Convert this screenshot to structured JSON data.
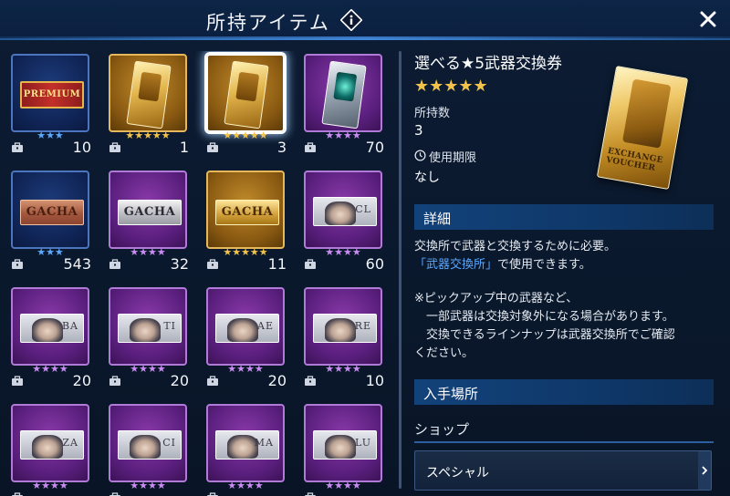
{
  "header": {
    "title": "所持アイテム",
    "info_icon": "info-icon",
    "close_icon": "close-icon"
  },
  "grid": [
    {
      "kind": "ticket-premium",
      "label": "PREMIUM",
      "stars": "★★★",
      "star_color": "#5aa9ff",
      "rarity": 3,
      "qty": "10"
    },
    {
      "kind": "voucher-gold",
      "stars": "★★★★★",
      "star_color": "#f2c24a",
      "rarity": 5,
      "qty": "1"
    },
    {
      "kind": "voucher-gold",
      "stars": "★★★★★",
      "star_color": "#f2c24a",
      "rarity": 5,
      "qty": "3",
      "selected": true
    },
    {
      "kind": "voucher-silver",
      "stars": "★★★★",
      "star_color": "#c98cf2",
      "rarity": 4,
      "qty": "70"
    },
    {
      "kind": "ticket-copper",
      "label": "GACHA",
      "stars": "★★★",
      "star_color": "#5aa9ff",
      "rarity": 3,
      "qty": "543"
    },
    {
      "kind": "ticket-silver",
      "label": "GACHA",
      "stars": "★★★★",
      "star_color": "#c98cf2",
      "rarity": 4,
      "qty": "32"
    },
    {
      "kind": "ticket-gold",
      "label": "GACHA",
      "stars": "★★★★★",
      "star_color": "#f2c24a",
      "rarity": 5,
      "qty": "11"
    },
    {
      "kind": "portrait",
      "code": "CL",
      "stars": "★★★★",
      "star_color": "#c98cf2",
      "rarity": 4,
      "qty": "60"
    },
    {
      "kind": "portrait",
      "code": "BA",
      "stars": "★★★★",
      "star_color": "#c98cf2",
      "rarity": 4,
      "qty": "20"
    },
    {
      "kind": "portrait",
      "code": "TI",
      "stars": "★★★★",
      "star_color": "#c98cf2",
      "rarity": 4,
      "qty": "20"
    },
    {
      "kind": "portrait",
      "code": "AE",
      "stars": "★★★★",
      "star_color": "#c98cf2",
      "rarity": 4,
      "qty": "20"
    },
    {
      "kind": "portrait",
      "code": "RE",
      "stars": "★★★★",
      "star_color": "#c98cf2",
      "rarity": 4,
      "qty": "10"
    },
    {
      "kind": "portrait",
      "code": "ZA",
      "stars": "★★★★",
      "star_color": "#c98cf2",
      "rarity": 4,
      "qty": ""
    },
    {
      "kind": "portrait",
      "code": "CI",
      "stars": "★★★★",
      "star_color": "#c98cf2",
      "rarity": 4,
      "qty": ""
    },
    {
      "kind": "portrait",
      "code": "MA",
      "stars": "★★★★",
      "star_color": "#c98cf2",
      "rarity": 4,
      "qty": ""
    },
    {
      "kind": "portrait",
      "code": "LU",
      "stars": "★★★★",
      "star_color": "#c98cf2",
      "rarity": 4,
      "qty": ""
    }
  ],
  "detail": {
    "name": "選べる★5武器交換券",
    "stars": "★★★★★",
    "owned_label": "所持数",
    "owned_value": "3",
    "expiry_label": "使用期限",
    "expiry_value": "なし",
    "voucher_text": "EXCHANGE VOUCHER",
    "section_detail": "詳細",
    "desc_line1": "交換所で武器と交換するために必要。",
    "desc_link": "「武器交換所」",
    "desc_line2_rest": "で使用できます。",
    "note_line1": "※ピックアップ中の武器など、",
    "note_line2": "　一部武器は交換対象外になる場合があります。",
    "note_line3": "　交換できるラインナップは武器交換所でご確認",
    "note_line4": "ください。",
    "section_source": "入手場所",
    "shop_label": "ショップ",
    "shop_button": "スペシャル"
  },
  "colors": {
    "accent_blue": "#58a8ff",
    "gold_star": "#f2c24a",
    "section_bg": "#12427a"
  }
}
